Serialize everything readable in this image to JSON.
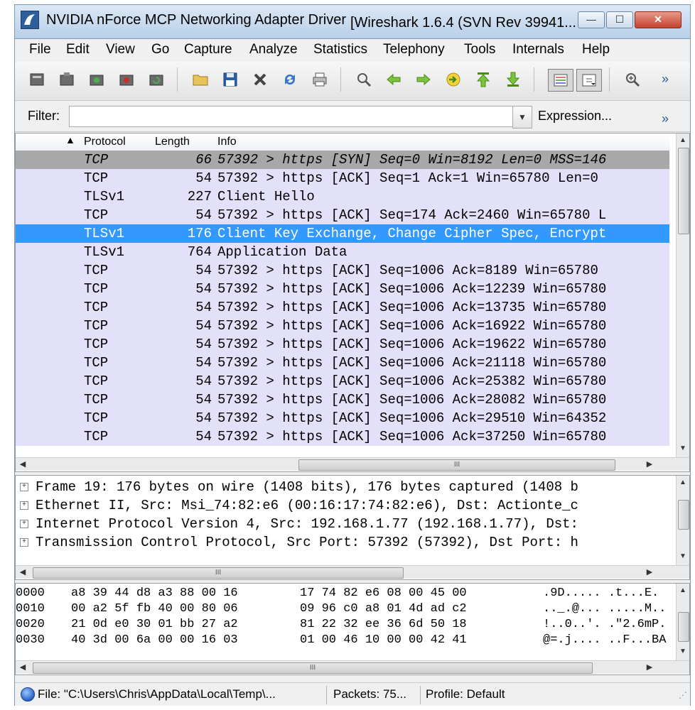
{
  "window": {
    "title": "NVIDIA nForce MCP Networking Adapter Driver",
    "title_sub": "[Wireshark 1.6.4  (SVN Rev 39941...",
    "buttons": {
      "minimize": "—",
      "maximize": "☐",
      "close": "✕"
    }
  },
  "menu": [
    {
      "label": "File"
    },
    {
      "label": "Edit"
    },
    {
      "label": "View"
    },
    {
      "label": "Go"
    },
    {
      "label": "Capture"
    },
    {
      "label": "Analyze"
    },
    {
      "label": "Statistics"
    },
    {
      "label": "Telephony"
    },
    {
      "label": "Tools"
    },
    {
      "label": "Internals"
    },
    {
      "label": "Help"
    }
  ],
  "toolbar": {
    "overflow": "»",
    "icons": [
      "interface-list-icon",
      "capture-options-icon",
      "start-capture-icon",
      "stop-capture-icon",
      "restart-capture-icon",
      "open-file-icon",
      "save-file-icon",
      "close-file-icon",
      "reload-icon",
      "print-icon",
      "find-packet-icon",
      "go-back-icon",
      "go-forward-icon",
      "go-to-packet-icon",
      "first-packet-icon",
      "last-packet-icon",
      "colorize-icon",
      "auto-scroll-icon",
      "zoom-in-icon"
    ]
  },
  "filter": {
    "label": "Filter:",
    "value": "",
    "placeholder": "",
    "expression_label": "Expression...",
    "overflow": "»"
  },
  "packet_list": {
    "columns": {
      "sort_arrow": "▲",
      "protocol": "Protocol",
      "length": "Length",
      "info": "Info"
    },
    "rows": [
      {
        "protocol": "TCP",
        "length": "66",
        "info": "57392 > https [SYN] Seq=0 Win=8192 Len=0 MSS=146",
        "state": "gray"
      },
      {
        "protocol": "TCP",
        "length": "54",
        "info": "57392 > https [ACK] Seq=1 Ack=1 Win=65780 Len=0",
        "state": "normal"
      },
      {
        "protocol": "TLSv1",
        "length": "227",
        "info": "Client Hello",
        "state": "normal"
      },
      {
        "protocol": "TCP",
        "length": "54",
        "info": "57392 > https [ACK] Seq=174 Ack=2460 Win=65780 L",
        "state": "normal"
      },
      {
        "protocol": "TLSv1",
        "length": "176",
        "info": "Client Key Exchange, Change Cipher Spec, Encrypt",
        "state": "selected"
      },
      {
        "protocol": "TLSv1",
        "length": "764",
        "info": "Application Data",
        "state": "normal"
      },
      {
        "protocol": "TCP",
        "length": "54",
        "info": "57392 > https [ACK] Seq=1006 Ack=8189 Win=65780",
        "state": "normal"
      },
      {
        "protocol": "TCP",
        "length": "54",
        "info": "57392 > https [ACK] Seq=1006 Ack=12239 Win=65780",
        "state": "normal"
      },
      {
        "protocol": "TCP",
        "length": "54",
        "info": "57392 > https [ACK] Seq=1006 Ack=13735 Win=65780",
        "state": "normal"
      },
      {
        "protocol": "TCP",
        "length": "54",
        "info": "57392 > https [ACK] Seq=1006 Ack=16922 Win=65780",
        "state": "normal"
      },
      {
        "protocol": "TCP",
        "length": "54",
        "info": "57392 > https [ACK] Seq=1006 Ack=19622 Win=65780",
        "state": "normal"
      },
      {
        "protocol": "TCP",
        "length": "54",
        "info": "57392 > https [ACK] Seq=1006 Ack=21118 Win=65780",
        "state": "normal"
      },
      {
        "protocol": "TCP",
        "length": "54",
        "info": "57392 > https [ACK] Seq=1006 Ack=25382 Win=65780",
        "state": "normal"
      },
      {
        "protocol": "TCP",
        "length": "54",
        "info": "57392 > https [ACK] Seq=1006 Ack=28082 Win=65780",
        "state": "normal"
      },
      {
        "protocol": "TCP",
        "length": "54",
        "info": "57392 > https [ACK] Seq=1006 Ack=29510 Win=64352",
        "state": "normal"
      },
      {
        "protocol": "TCP",
        "length": "54",
        "info": "57392 > https [ACK] Seq=1006 Ack=37250 Win=65780",
        "state": "normal"
      }
    ]
  },
  "scroll": {
    "up": "▲",
    "down": "▼",
    "left": "◀",
    "right": "▶",
    "grip": "III"
  },
  "packet_details": {
    "expander": "+",
    "rows": [
      "Frame 19: 176 bytes on wire (1408 bits), 176 bytes captured (1408 b",
      "Ethernet II, Src: Msi_74:82:e6 (00:16:17:74:82:e6), Dst: Actionte_c",
      "Internet Protocol Version 4, Src: 192.168.1.77 (192.168.1.77), Dst:",
      "Transmission Control Protocol, Src Port: 57392 (57392), Dst Port: h"
    ]
  },
  "hex": {
    "lines": [
      {
        "offset": "0000",
        "a": "a8 39 44 d8 a3 88 00 16",
        "b": "17 74 82 e6 08 00 45 00",
        "ascii": ".9D..... .t...E."
      },
      {
        "offset": "0010",
        "a": "00 a2 5f fb 40 00 80 06",
        "b": "09 96 c0 a8 01 4d ad c2",
        "ascii": ".._.@... .....M.."
      },
      {
        "offset": "0020",
        "a": "21 0d e0 30 01 bb 27 a2",
        "b": "81 22 32 ee 36 6d 50 18",
        "ascii": "!..0..'. .\"2.6mP."
      },
      {
        "offset": "0030",
        "a": "40 3d 00 6a 00 00 16 03",
        "b": "01 00 46 10 00 00 42 41",
        "ascii": "@=.j.... ..F...BA"
      }
    ]
  },
  "status": {
    "file": "File: \"C:\\Users\\Chris\\AppData\\Local\\Temp\\...",
    "packets": "Packets: 75...",
    "profile": "Profile: Default"
  },
  "colors": {
    "row_bg": "#e3e0fa",
    "gray_row_bg": "#a8a8a8",
    "selected_bg": "#3399ff"
  }
}
